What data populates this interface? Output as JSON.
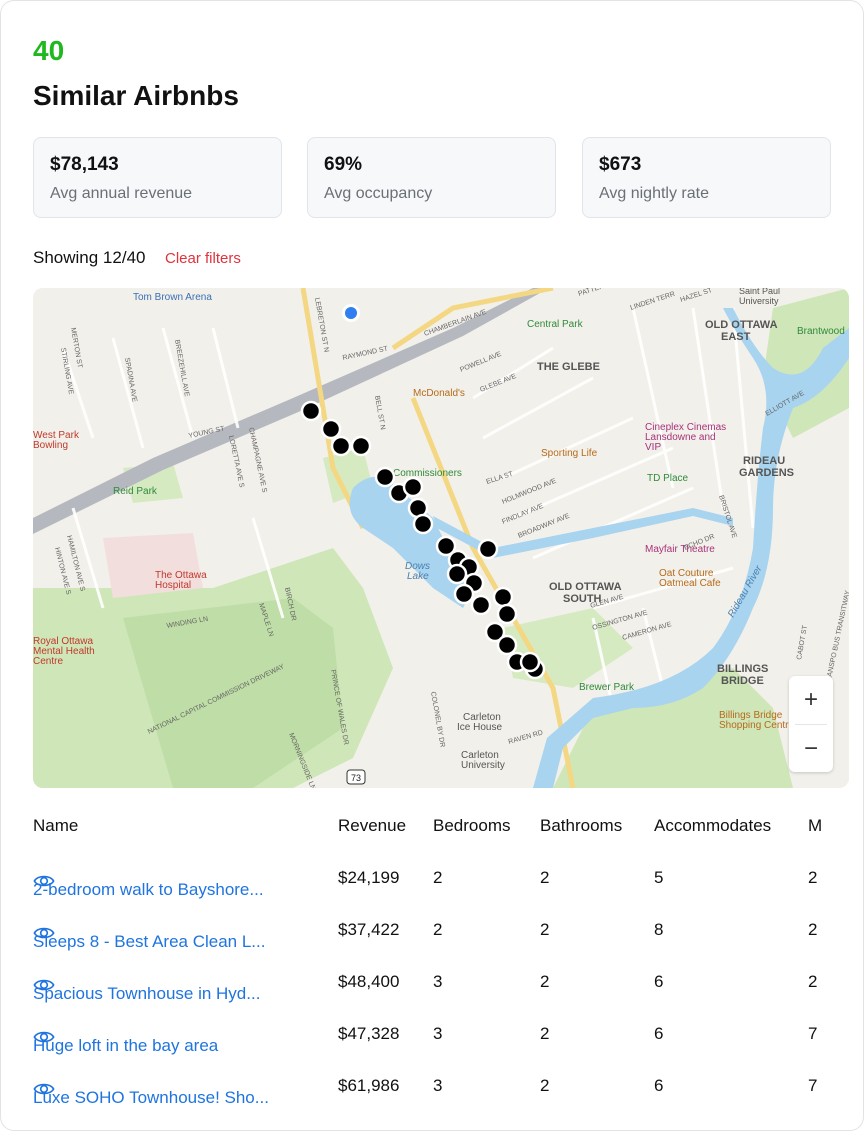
{
  "header": {
    "count": "40",
    "title": "Similar Airbnbs"
  },
  "stats": [
    {
      "value": "$78,143",
      "label": "Avg annual revenue"
    },
    {
      "value": "69%",
      "label": "Avg occupancy"
    },
    {
      "value": "$673",
      "label": "Avg nightly rate"
    }
  ],
  "filter": {
    "showing": "Showing 12/40",
    "clear_label": "Clear filters"
  },
  "map": {
    "zoom_in": "+",
    "zoom_out": "−",
    "labels": {
      "tom_brown": "Tom Brown Arena",
      "central_park": "Central Park",
      "the_glebe": "THE GLEBE",
      "old_ottawa_east_1": "OLD OTTAWA",
      "old_ottawa_east_2": "EAST",
      "brantwood": "Brantwood",
      "saint_paul_1": "Saint Paul",
      "saint_paul_2": "University",
      "mcdonalds": "McDonald's",
      "west_park_1": "West Park",
      "west_park_2": "Bowling",
      "reid_park": "Reid Park",
      "commissioners": "Commissioners",
      "sporting_life": "Sporting Life",
      "cineplex_1": "Cineplex Cinemas",
      "cineplex_2": "Lansdowne and",
      "cineplex_3": "VIP",
      "td_place": "TD Place",
      "rideau_gardens_1": "RIDEAU",
      "rideau_gardens_2": "GARDENS",
      "ottawa_hospital_1": "The Ottawa",
      "ottawa_hospital_2": "Hospital",
      "dows_lake_1": "Dows",
      "dows_lake_2": "Lake",
      "mayfair": "Mayfair Theatre",
      "oat_couture_1": "Oat Couture",
      "oat_couture_2": "Oatmeal Cafe",
      "old_ottawa_south_1": "OLD OTTAWA",
      "old_ottawa_south_2": "SOUTH",
      "royal_ottawa_1": "Royal Ottawa",
      "royal_ottawa_2": "Mental Health",
      "royal_ottawa_3": "Centre",
      "brewer_park": "Brewer Park",
      "billings_bridge_1": "BILLINGS",
      "billings_bridge_2": "BRIDGE",
      "billings_centre_1": "Billings Bridge",
      "billings_centre_2": "Shopping Centre",
      "carleton_ice_1": "Carleton",
      "carleton_ice_2": "Ice House",
      "carleton_u_1": "Carleton",
      "carleton_u_2": "University",
      "rideau_river": "Rideau River",
      "highway": "73",
      "streets": {
        "merton": "MERTON ST",
        "stirling": "STIRLING AVE",
        "spadina": "SPADINA AVE",
        "breezehill": "BREEZEHILL AVE",
        "lebreton": "LEBRETON ST N",
        "bell": "BELL ST N",
        "raymond": "RAYMOND ST",
        "chamberlain": "CHAMBERLAIN AVE",
        "powell": "POWELL AVE",
        "glebe_ave": "GLEBE AVE",
        "young": "YOUNG ST",
        "champagne": "CHAMPAGNE AVE S",
        "loretta": "LORETTA AVE S",
        "ella": "ELLA ST",
        "holmwood": "HOLMWOOD AVE",
        "findlay": "FINDLAY AVE",
        "broadway": "BROADWAY AVE",
        "hamilton": "HAMILTON AVE S",
        "hinton": "HINTON AVE S",
        "winding": "WINDING LN",
        "maple": "MAPLE LN",
        "birch": "BIRCH DR",
        "ncc": "NATIONAL CAPITAL COMMISSION DRIVEWAY",
        "prince": "PRINCE OF WALES DR",
        "morningside": "MORNINGSIDE LN",
        "colonel_by": "COLONEL BY DR",
        "raven": "RAVEN RD",
        "glen": "GLEN AVE",
        "ossington": "OSSINGTON AVE",
        "cameron": "CAMERON AVE",
        "elliott": "ELLIOTT AVE",
        "echo": "ECHO DR",
        "bristol": "BRISTOL AVE",
        "linden": "LINDEN TERR",
        "hazel": "HAZEL ST",
        "patterson": "PATTERSON",
        "cabot": "CABOT ST",
        "oc_transpo": "OC TRANSPO BUS TRANSITWAY"
      }
    }
  },
  "table": {
    "columns": [
      "Name",
      "Revenue",
      "Bedrooms",
      "Bathrooms",
      "Accommodates",
      "M"
    ],
    "rows": [
      {
        "name": "2-bedroom walk to Bayshore...",
        "revenue": "$24,199",
        "bedrooms": "2",
        "bathrooms": "2",
        "accommodates": "5",
        "m": "2"
      },
      {
        "name": "Sleeps 8 - Best Area Clean L...",
        "revenue": "$37,422",
        "bedrooms": "2",
        "bathrooms": "2",
        "accommodates": "8",
        "m": "2"
      },
      {
        "name": "Spacious Townhouse in Hyd...",
        "revenue": "$48,400",
        "bedrooms": "3",
        "bathrooms": "2",
        "accommodates": "6",
        "m": "2"
      },
      {
        "name": "Huge loft in the bay area",
        "revenue": "$47,328",
        "bedrooms": "3",
        "bathrooms": "2",
        "accommodates": "6",
        "m": "7"
      },
      {
        "name": "Luxe SOHO Townhouse! Sho...",
        "revenue": "$61,986",
        "bedrooms": "3",
        "bathrooms": "2",
        "accommodates": "6",
        "m": "7"
      }
    ]
  }
}
